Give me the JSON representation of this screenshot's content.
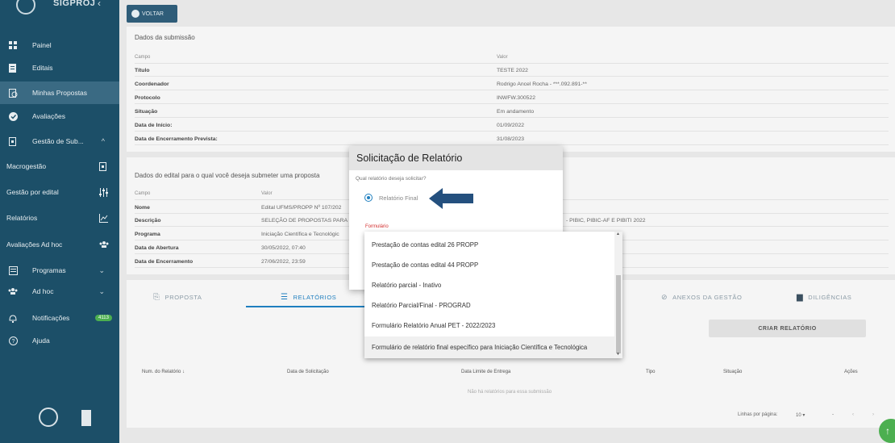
{
  "sidebar": {
    "brand": "SIGPROJ",
    "items": [
      {
        "label": "Painel",
        "icon": "dashboard-icon"
      },
      {
        "label": "Editais",
        "icon": "document-icon"
      },
      {
        "label": "Minhas Propostas",
        "icon": "proposals-icon"
      },
      {
        "label": "Avaliações",
        "icon": "check-circle-icon"
      },
      {
        "label": "Gestão de Sub...",
        "icon": "file-icon"
      },
      {
        "label": "Macrogestão",
        "icon": "file-icon"
      },
      {
        "label": "Gestão por edital",
        "icon": "sliders-icon"
      },
      {
        "label": "Relatórios",
        "icon": "chart-icon"
      },
      {
        "label": "Avaliações Ad hoc",
        "icon": "group-icon"
      },
      {
        "label": "Programas",
        "icon": "folder-icon"
      },
      {
        "label": "Ad hoc",
        "icon": "group-icon"
      },
      {
        "label": "Notificações",
        "icon": "bell-icon",
        "badge": "4113"
      },
      {
        "label": "Ajuda",
        "icon": "help-icon"
      }
    ]
  },
  "voltar_label": "VOLTAR",
  "submission": {
    "title": "Dados da submissão",
    "col_field": "Campo",
    "col_value": "Valor",
    "rows": [
      {
        "k": "Título",
        "v": "TESTE 2022"
      },
      {
        "k": "Coordenador",
        "v": "Rodrigo Ancel Rocha - ***.092.891-**"
      },
      {
        "k": "Protocolo",
        "v": "INWFW.300522"
      },
      {
        "k": "Situação",
        "v": "Em andamento"
      },
      {
        "k": "Data de Início:",
        "v": "01/09/2022"
      },
      {
        "k": "Data de Encerramento Prevista:",
        "v": "31/08/2023"
      }
    ]
  },
  "edital": {
    "title": "Dados do edital para o qual você deseja submeter uma proposta",
    "col_field": "Campo",
    "col_value": "Valor",
    "rows": [
      {
        "k": "Nome",
        "v": "Edital UFMS/PROPP Nº 107/202"
      },
      {
        "k": "Descrição",
        "v": "SELEÇÃO DE PROPOSTAS PARA"
      },
      {
        "k": "Programa",
        "v": "Iniciação Científica e Tecnológic"
      },
      {
        "k": "Data de Abertura",
        "v": "30/05/2022, 07:40"
      },
      {
        "k": "Data de Encerramento",
        "v": "27/06/2022, 23:59"
      }
    ],
    "desc_tail": "- PIBIC, PIBIC-AF E PIBITI 2022"
  },
  "tabs": [
    {
      "label": "PROPOSTA"
    },
    {
      "label": "RELATÓRIOS"
    },
    {
      "label": "ANEXOS DA GESTÃO"
    },
    {
      "label": "DILIGÊNCIAS"
    }
  ],
  "criar_label": "CRIAR RELATÓRIO",
  "table": {
    "headers": [
      "Num. do Relatório ↓",
      "Data de Solicitação",
      "Data Limite de Entrega",
      "Tipo",
      "Situação",
      "Ações"
    ],
    "empty": "Não há relatórios para essa submissão",
    "rows_per_page_label": "Linhas por página:",
    "rows_per_page": "10",
    "range": "-"
  },
  "dialog": {
    "title": "Solicitação de Relatório",
    "question": "Qual relatório deseja solicitar?",
    "radio_option": "Relatório Final",
    "formulario_label": "Formulário"
  },
  "dropdown": {
    "options": [
      "Prestação de contas edital 26 PROPP",
      "Prestação de contas edital 44 PROPP",
      "Relatório parcial - Inativo",
      "Relatório Parcial/Final - PROGRAD",
      "Formulário Relatório Anual PET - 2022/2023",
      "Formulário de relatório final específico para Iniciação Científica e Tecnológica"
    ]
  },
  "colors": {
    "sidebar": "#1c4f68",
    "accent": "#1f7fbf",
    "arrow": "#24507e"
  }
}
